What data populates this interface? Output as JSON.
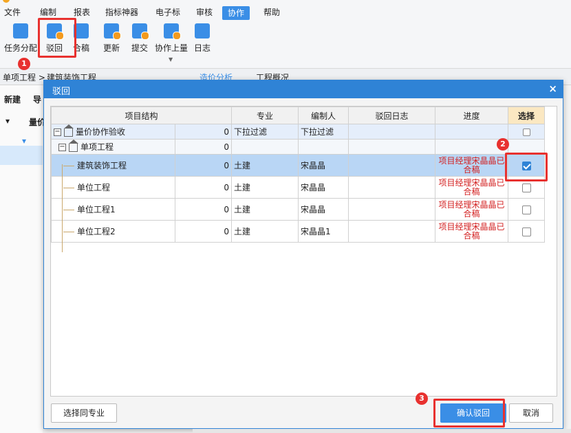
{
  "menubar": {
    "items": [
      "文件",
      "编制",
      "报表",
      "指标神器",
      "电子标",
      "审核",
      "协作",
      "帮助"
    ],
    "active": "协作"
  },
  "toolbar": {
    "tools": [
      "任务分配",
      "驳回",
      "合稿",
      "更新",
      "提交",
      "协作上量",
      "日志"
    ]
  },
  "doc_tabs": {
    "breadcrumb": "单项工程 >",
    "tab_a": "建筑装饰工程",
    "tab_b": "造价分析",
    "tab_c": "工程概况"
  },
  "left_panel": {
    "new_label": "新建",
    "import_label": "导",
    "root_label": "量价"
  },
  "dialog": {
    "title": "驳回",
    "close": "×",
    "columns": [
      "项目结构",
      "",
      "专业",
      "编制人",
      "驳回日志",
      "进度",
      "选择"
    ],
    "rows": [
      {
        "name": "量价协作验收",
        "num": "0",
        "major": "下拉过滤",
        "author": "下拉过滤",
        "log": "",
        "progress": "",
        "checked": false,
        "level": 0
      },
      {
        "name": "单项工程",
        "num": "0",
        "major": "",
        "author": "",
        "log": "",
        "progress": "",
        "checked": false,
        "level": 1
      },
      {
        "name": "建筑装饰工程",
        "num": "0",
        "major": "土建",
        "author": "宋晶晶",
        "log": "",
        "progress": "项目经理宋晶晶已合稿",
        "checked": true,
        "level": 2
      },
      {
        "name": "单位工程",
        "num": "0",
        "major": "土建",
        "author": "宋晶晶",
        "log": "",
        "progress": "项目经理宋晶晶已合稿",
        "checked": false,
        "level": 2
      },
      {
        "name": "单位工程1",
        "num": "0",
        "major": "土建",
        "author": "宋晶晶",
        "log": "",
        "progress": "项目经理宋晶晶已合稿",
        "checked": false,
        "level": 2
      },
      {
        "name": "单位工程2",
        "num": "0",
        "major": "土建",
        "author": "宋晶晶1",
        "log": "",
        "progress": "项目经理宋晶晶已合稿",
        "checked": false,
        "level": 2
      }
    ],
    "btn_select_same": "选择同专业",
    "btn_confirm": "确认驳回",
    "btn_cancel": "取消"
  },
  "annotations": [
    "1",
    "2",
    "3"
  ],
  "colors": {
    "accent": "#2f83d6",
    "annotation": "#e8312f",
    "progress_text": "#d32020"
  }
}
